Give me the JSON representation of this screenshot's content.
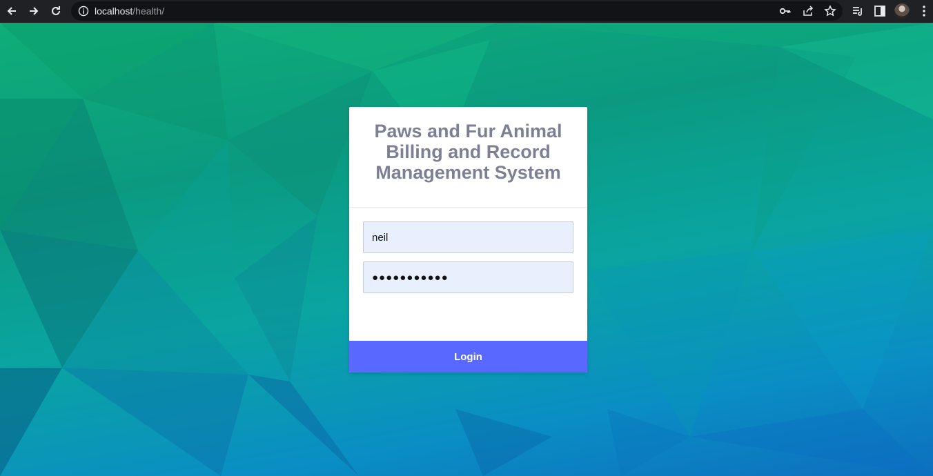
{
  "browser": {
    "url_host": "localhost",
    "url_path": "/health/",
    "icons": [
      "back-icon",
      "forward-icon",
      "reload-icon",
      "info-icon",
      "key-icon",
      "share-icon",
      "star-icon",
      "reading-list-icon",
      "side-panel-icon",
      "avatar",
      "menu-icon"
    ]
  },
  "login": {
    "title": "Paws and Fur Animal Billing and Record Management System",
    "username_value": "neil",
    "password_value": "●●●●●●●●●●●",
    "button_label": "Login"
  },
  "colors": {
    "card_title": "#7d7f95",
    "field_background": "#e8f0fe",
    "login_button": "#5969ff"
  }
}
